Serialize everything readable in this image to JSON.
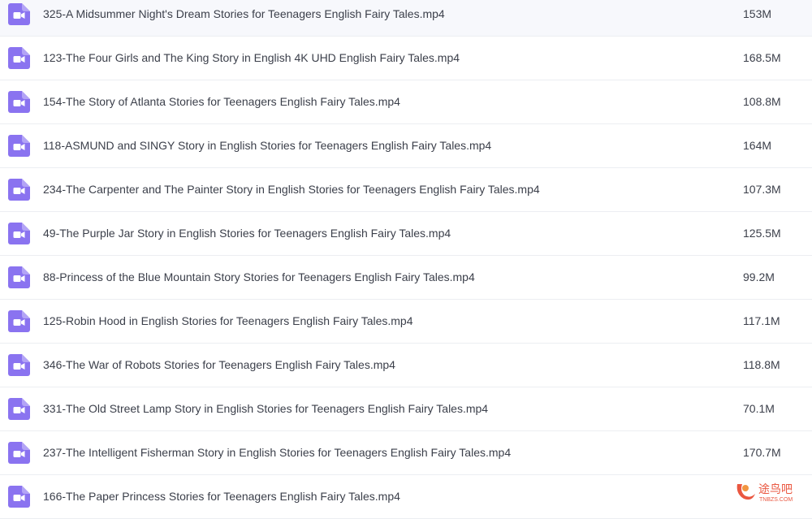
{
  "icon": "video-file-icon",
  "colors": {
    "icon_bg": "#8a73f0",
    "text": "#3b3f4a",
    "divider": "#eceef2",
    "watermark": "#e8452c"
  },
  "files": [
    {
      "name": "325-A Midsummer Night's Dream Stories for Teenagers English Fairy Tales.mp4",
      "size": "153M"
    },
    {
      "name": "123-The Four Girls and The King Story in English 4K UHD English Fairy Tales.mp4",
      "size": "168.5M"
    },
    {
      "name": "154-The Story of Atlanta Stories for Teenagers English Fairy Tales.mp4",
      "size": "108.8M"
    },
    {
      "name": "118-ASMUND and SINGY Story in English Stories for Teenagers English Fairy Tales.mp4",
      "size": "164M"
    },
    {
      "name": "234-The Carpenter and The Painter Story in English Stories for Teenagers English Fairy Tales.mp4",
      "size": "107.3M"
    },
    {
      "name": "49-The Purple Jar Story in English Stories for Teenagers English Fairy Tales.mp4",
      "size": "125.5M"
    },
    {
      "name": "88-Princess of the Blue Mountain Story Stories for Teenagers English Fairy Tales.mp4",
      "size": "99.2M"
    },
    {
      "name": "125-Robin Hood in English Stories for Teenagers English Fairy Tales.mp4",
      "size": "117.1M"
    },
    {
      "name": "346-The War of Robots Stories for Teenagers English Fairy Tales.mp4",
      "size": "118.8M"
    },
    {
      "name": "331-The Old Street Lamp Story in English Stories for Teenagers English Fairy Tales.mp4",
      "size": "70.1M"
    },
    {
      "name": "237-The Intelligent Fisherman Story in English Stories for Teenagers English Fairy Tales.mp4",
      "size": "170.7M"
    },
    {
      "name": "166-The Paper Princess Stories for Teenagers English Fairy Tales.mp4",
      "size": ""
    }
  ],
  "watermark": {
    "logo": "tubaba-logo",
    "text": "途鸟吧",
    "domain": "TNBZS.COM"
  }
}
